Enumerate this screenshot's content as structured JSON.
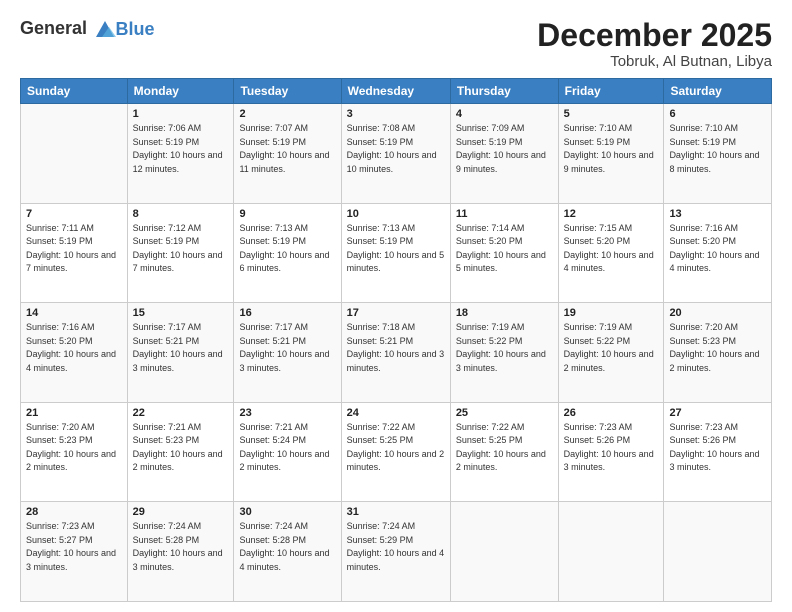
{
  "logo": {
    "general": "General",
    "blue": "Blue"
  },
  "header": {
    "month": "December 2025",
    "location": "Tobruk, Al Butnan, Libya"
  },
  "days_of_week": [
    "Sunday",
    "Monday",
    "Tuesday",
    "Wednesday",
    "Thursday",
    "Friday",
    "Saturday"
  ],
  "weeks": [
    [
      {
        "day": "",
        "sunrise": "",
        "sunset": "",
        "daylight": ""
      },
      {
        "day": "1",
        "sunrise": "Sunrise: 7:06 AM",
        "sunset": "Sunset: 5:19 PM",
        "daylight": "Daylight: 10 hours and 12 minutes."
      },
      {
        "day": "2",
        "sunrise": "Sunrise: 7:07 AM",
        "sunset": "Sunset: 5:19 PM",
        "daylight": "Daylight: 10 hours and 11 minutes."
      },
      {
        "day": "3",
        "sunrise": "Sunrise: 7:08 AM",
        "sunset": "Sunset: 5:19 PM",
        "daylight": "Daylight: 10 hours and 10 minutes."
      },
      {
        "day": "4",
        "sunrise": "Sunrise: 7:09 AM",
        "sunset": "Sunset: 5:19 PM",
        "daylight": "Daylight: 10 hours and 9 minutes."
      },
      {
        "day": "5",
        "sunrise": "Sunrise: 7:10 AM",
        "sunset": "Sunset: 5:19 PM",
        "daylight": "Daylight: 10 hours and 9 minutes."
      },
      {
        "day": "6",
        "sunrise": "Sunrise: 7:10 AM",
        "sunset": "Sunset: 5:19 PM",
        "daylight": "Daylight: 10 hours and 8 minutes."
      }
    ],
    [
      {
        "day": "7",
        "sunrise": "Sunrise: 7:11 AM",
        "sunset": "Sunset: 5:19 PM",
        "daylight": "Daylight: 10 hours and 7 minutes."
      },
      {
        "day": "8",
        "sunrise": "Sunrise: 7:12 AM",
        "sunset": "Sunset: 5:19 PM",
        "daylight": "Daylight: 10 hours and 7 minutes."
      },
      {
        "day": "9",
        "sunrise": "Sunrise: 7:13 AM",
        "sunset": "Sunset: 5:19 PM",
        "daylight": "Daylight: 10 hours and 6 minutes."
      },
      {
        "day": "10",
        "sunrise": "Sunrise: 7:13 AM",
        "sunset": "Sunset: 5:19 PM",
        "daylight": "Daylight: 10 hours and 5 minutes."
      },
      {
        "day": "11",
        "sunrise": "Sunrise: 7:14 AM",
        "sunset": "Sunset: 5:20 PM",
        "daylight": "Daylight: 10 hours and 5 minutes."
      },
      {
        "day": "12",
        "sunrise": "Sunrise: 7:15 AM",
        "sunset": "Sunset: 5:20 PM",
        "daylight": "Daylight: 10 hours and 4 minutes."
      },
      {
        "day": "13",
        "sunrise": "Sunrise: 7:16 AM",
        "sunset": "Sunset: 5:20 PM",
        "daylight": "Daylight: 10 hours and 4 minutes."
      }
    ],
    [
      {
        "day": "14",
        "sunrise": "Sunrise: 7:16 AM",
        "sunset": "Sunset: 5:20 PM",
        "daylight": "Daylight: 10 hours and 4 minutes."
      },
      {
        "day": "15",
        "sunrise": "Sunrise: 7:17 AM",
        "sunset": "Sunset: 5:21 PM",
        "daylight": "Daylight: 10 hours and 3 minutes."
      },
      {
        "day": "16",
        "sunrise": "Sunrise: 7:17 AM",
        "sunset": "Sunset: 5:21 PM",
        "daylight": "Daylight: 10 hours and 3 minutes."
      },
      {
        "day": "17",
        "sunrise": "Sunrise: 7:18 AM",
        "sunset": "Sunset: 5:21 PM",
        "daylight": "Daylight: 10 hours and 3 minutes."
      },
      {
        "day": "18",
        "sunrise": "Sunrise: 7:19 AM",
        "sunset": "Sunset: 5:22 PM",
        "daylight": "Daylight: 10 hours and 3 minutes."
      },
      {
        "day": "19",
        "sunrise": "Sunrise: 7:19 AM",
        "sunset": "Sunset: 5:22 PM",
        "daylight": "Daylight: 10 hours and 2 minutes."
      },
      {
        "day": "20",
        "sunrise": "Sunrise: 7:20 AM",
        "sunset": "Sunset: 5:23 PM",
        "daylight": "Daylight: 10 hours and 2 minutes."
      }
    ],
    [
      {
        "day": "21",
        "sunrise": "Sunrise: 7:20 AM",
        "sunset": "Sunset: 5:23 PM",
        "daylight": "Daylight: 10 hours and 2 minutes."
      },
      {
        "day": "22",
        "sunrise": "Sunrise: 7:21 AM",
        "sunset": "Sunset: 5:23 PM",
        "daylight": "Daylight: 10 hours and 2 minutes."
      },
      {
        "day": "23",
        "sunrise": "Sunrise: 7:21 AM",
        "sunset": "Sunset: 5:24 PM",
        "daylight": "Daylight: 10 hours and 2 minutes."
      },
      {
        "day": "24",
        "sunrise": "Sunrise: 7:22 AM",
        "sunset": "Sunset: 5:25 PM",
        "daylight": "Daylight: 10 hours and 2 minutes."
      },
      {
        "day": "25",
        "sunrise": "Sunrise: 7:22 AM",
        "sunset": "Sunset: 5:25 PM",
        "daylight": "Daylight: 10 hours and 2 minutes."
      },
      {
        "day": "26",
        "sunrise": "Sunrise: 7:23 AM",
        "sunset": "Sunset: 5:26 PM",
        "daylight": "Daylight: 10 hours and 3 minutes."
      },
      {
        "day": "27",
        "sunrise": "Sunrise: 7:23 AM",
        "sunset": "Sunset: 5:26 PM",
        "daylight": "Daylight: 10 hours and 3 minutes."
      }
    ],
    [
      {
        "day": "28",
        "sunrise": "Sunrise: 7:23 AM",
        "sunset": "Sunset: 5:27 PM",
        "daylight": "Daylight: 10 hours and 3 minutes."
      },
      {
        "day": "29",
        "sunrise": "Sunrise: 7:24 AM",
        "sunset": "Sunset: 5:28 PM",
        "daylight": "Daylight: 10 hours and 3 minutes."
      },
      {
        "day": "30",
        "sunrise": "Sunrise: 7:24 AM",
        "sunset": "Sunset: 5:28 PM",
        "daylight": "Daylight: 10 hours and 4 minutes."
      },
      {
        "day": "31",
        "sunrise": "Sunrise: 7:24 AM",
        "sunset": "Sunset: 5:29 PM",
        "daylight": "Daylight: 10 hours and 4 minutes."
      },
      {
        "day": "",
        "sunrise": "",
        "sunset": "",
        "daylight": ""
      },
      {
        "day": "",
        "sunrise": "",
        "sunset": "",
        "daylight": ""
      },
      {
        "day": "",
        "sunrise": "",
        "sunset": "",
        "daylight": ""
      }
    ]
  ]
}
